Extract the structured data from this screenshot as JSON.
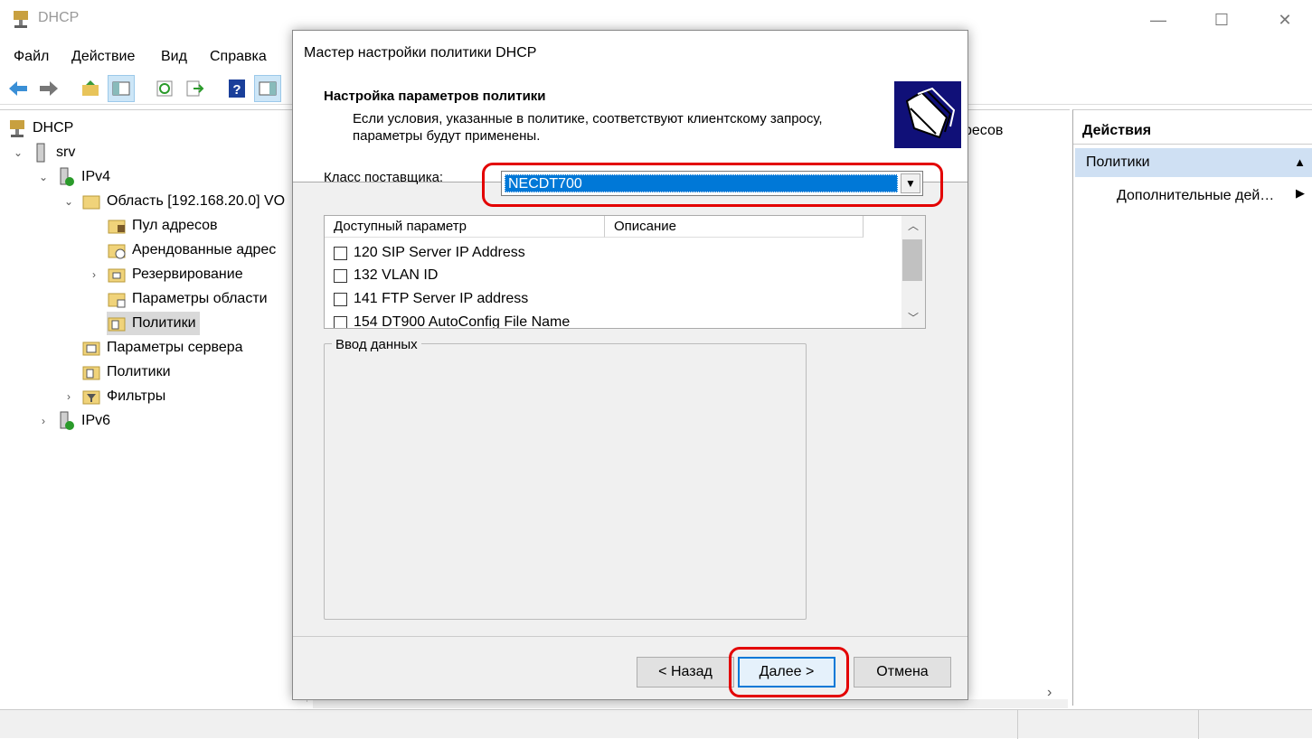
{
  "app": {
    "title": "DHCP"
  },
  "window_controls": {
    "minimize": "—",
    "maximize": "☐",
    "close": "✕"
  },
  "menu": [
    "Файл",
    "Действие",
    "Вид",
    "Справка"
  ],
  "tree": [
    {
      "label": "DHCP",
      "level": 0
    },
    {
      "label": "srv",
      "level": 1,
      "chevron": "expanded"
    },
    {
      "label": "IPv4",
      "level": 2,
      "chevron": "expanded"
    },
    {
      "label": "Область [192.168.20.0] VO",
      "level": 3,
      "chevron": "expanded"
    },
    {
      "label": "Пул адресов",
      "level": 4
    },
    {
      "label": "Арендованные адрес",
      "level": 4
    },
    {
      "label": "Резервирование",
      "level": 4,
      "chevron": "collapsed"
    },
    {
      "label": "Параметры области",
      "level": 4
    },
    {
      "label": "Политики",
      "level": 4,
      "selected": true
    },
    {
      "label": "Параметры сервера",
      "level": 3
    },
    {
      "label": "Политики",
      "level": 3
    },
    {
      "label": "Фильтры",
      "level": 3,
      "chevron": "collapsed"
    },
    {
      "label": "IPv6",
      "level": 2,
      "chevron": "collapsed"
    }
  ],
  "middle": {
    "partial_text": "ресов"
  },
  "actions": {
    "header": "Действия",
    "policies": "Политики",
    "more": "Дополнительные дей…",
    "collapse_glyph": "▲",
    "more_glyph": "▶"
  },
  "dialog": {
    "title": "Мастер настройки политики DHCP",
    "header_title": "Настройка параметров политики",
    "header_desc": "Если условия, указанные в политике, соответствуют клиентскому запросу, параметры будут применены.",
    "vendor_label": "Класс поставщика:",
    "vendor_value": "NECDT700",
    "columns": [
      "Доступный параметр",
      "Описание"
    ],
    "options": [
      "120 SIP Server IP Address",
      "132 VLAN ID",
      "141 FTP Server IP address",
      "154 DT900 AutoConfig File Name"
    ],
    "data_group": "Ввод данных",
    "buttons": {
      "back": "< Назад",
      "next": "Далее >",
      "cancel": "Отмена"
    }
  },
  "colors": {
    "selection": "#0078d7",
    "highlight": "#e30000",
    "wizard_image": "#101078"
  }
}
